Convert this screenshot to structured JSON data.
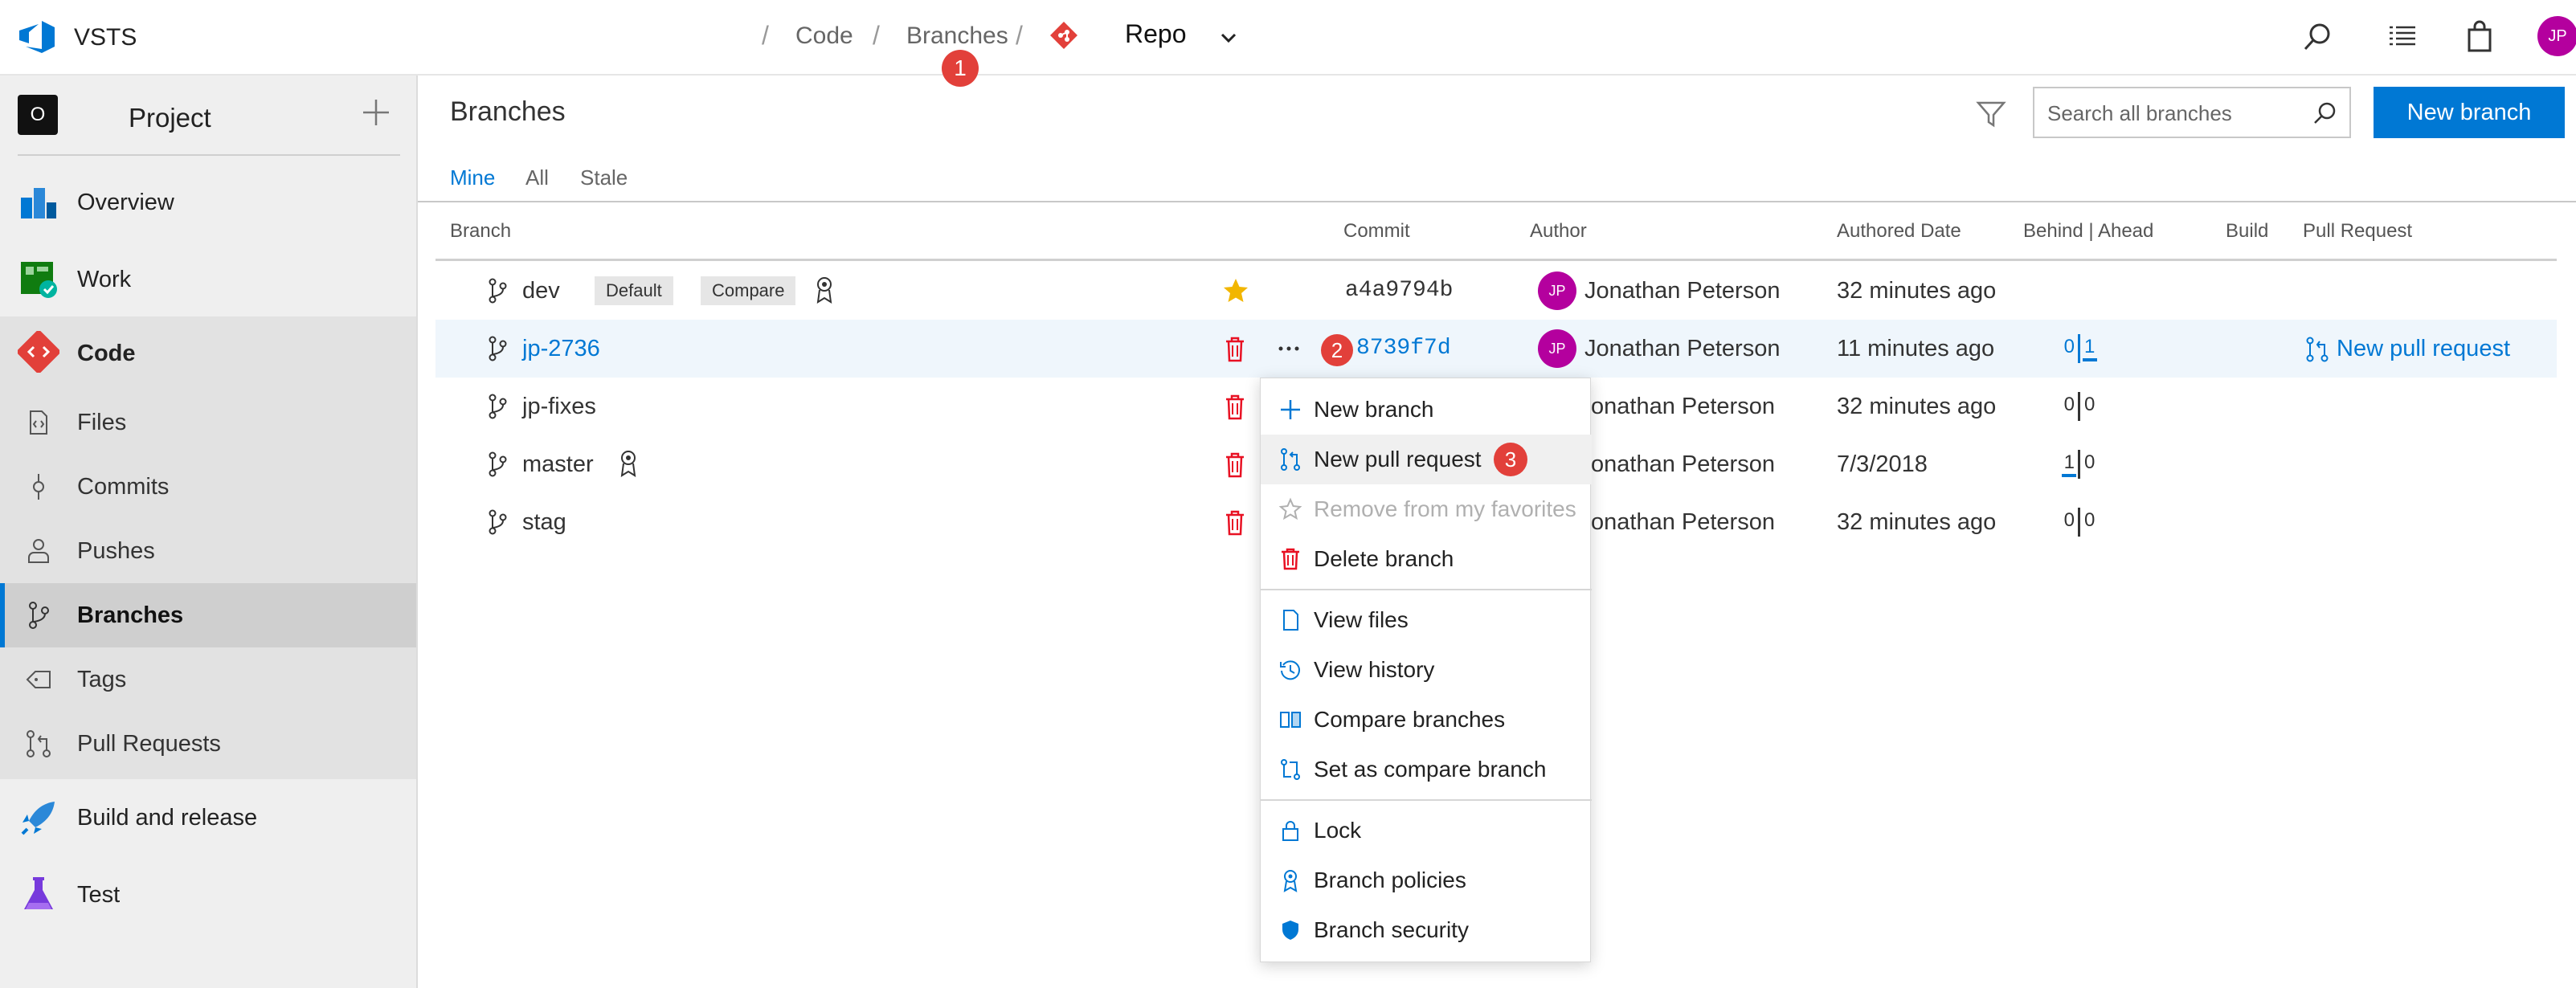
{
  "app": {
    "name": "VSTS",
    "user_initials": "JP"
  },
  "breadcrumb": {
    "code": "Code",
    "branches": "Branches",
    "repo": "Repo",
    "separator": "/"
  },
  "badges": {
    "one": "1",
    "two": "2",
    "three": "3"
  },
  "sidebar": {
    "project_initial": "O",
    "project_name": "Project",
    "items": [
      {
        "label": "Overview",
        "icon": "overview-icon"
      },
      {
        "label": "Work",
        "icon": "work-icon"
      },
      {
        "label": "Code",
        "icon": "code-icon"
      },
      {
        "label": "Build and release",
        "icon": "rocket-icon"
      },
      {
        "label": "Test",
        "icon": "flask-icon"
      }
    ],
    "code_items": [
      {
        "label": "Files",
        "icon": "file-icon"
      },
      {
        "label": "Commits",
        "icon": "commit-icon"
      },
      {
        "label": "Pushes",
        "icon": "push-icon"
      },
      {
        "label": "Branches",
        "icon": "branch-icon",
        "selected": true
      },
      {
        "label": "Tags",
        "icon": "tag-icon"
      },
      {
        "label": "Pull Requests",
        "icon": "pull-request-icon"
      }
    ]
  },
  "page": {
    "title": "Branches",
    "search_placeholder": "Search all branches",
    "new_branch_label": "New branch",
    "tabs": [
      "Mine",
      "All",
      "Stale"
    ],
    "active_tab": "Mine"
  },
  "table": {
    "columns": [
      "Branch",
      "Commit",
      "Author",
      "Authored Date",
      "Behind | Ahead",
      "Build",
      "Pull Request"
    ],
    "tags": {
      "default": "Default",
      "compare": "Compare"
    },
    "rows": [
      {
        "name": "dev",
        "commit": "a4a9794b",
        "author_initials": "JP",
        "author": "Jonathan Peterson",
        "date": "32 minutes ago",
        "behind": "",
        "ahead": "",
        "pull_request": ""
      },
      {
        "name": "jp-2736",
        "commit": "8739f7d",
        "author_initials": "JP",
        "author": "Jonathan Peterson",
        "date": "11 minutes ago",
        "behind": "0",
        "ahead": "1",
        "pull_request": "New pull request"
      },
      {
        "name": "jp-fixes",
        "commit": "",
        "author_initials": "",
        "author": "onathan Peterson",
        "date": "32 minutes ago",
        "behind": "0",
        "ahead": "0",
        "pull_request": ""
      },
      {
        "name": "master",
        "commit": "",
        "author_initials": "",
        "author": "onathan Peterson",
        "date": "7/3/2018",
        "behind": "1",
        "ahead": "0",
        "pull_request": ""
      },
      {
        "name": "stag",
        "commit": "",
        "author_initials": "",
        "author": "onathan Peterson",
        "date": "32 minutes ago",
        "behind": "0",
        "ahead": "0",
        "pull_request": ""
      }
    ]
  },
  "context_menu": {
    "items": [
      {
        "label": "New branch",
        "icon": "plus-icon"
      },
      {
        "label": "New pull request",
        "icon": "pull-request-icon"
      },
      {
        "label": "Remove from my favorites",
        "icon": "star-outline-icon",
        "disabled": true
      },
      {
        "label": "Delete branch",
        "icon": "trash-icon"
      },
      {
        "label": "View files",
        "icon": "file-icon"
      },
      {
        "label": "View history",
        "icon": "history-icon"
      },
      {
        "label": "Compare branches",
        "icon": "compare-icon"
      },
      {
        "label": "Set as compare branch",
        "icon": "set-compare-icon"
      },
      {
        "label": "Lock",
        "icon": "lock-icon"
      },
      {
        "label": "Branch policies",
        "icon": "policy-icon"
      },
      {
        "label": "Branch security",
        "icon": "shield-icon"
      }
    ]
  },
  "colors": {
    "accent": "#0078d4",
    "badge": "#e2403a",
    "avatar": "#b4009e",
    "star": "#f2b600",
    "trash": "#e81123"
  }
}
